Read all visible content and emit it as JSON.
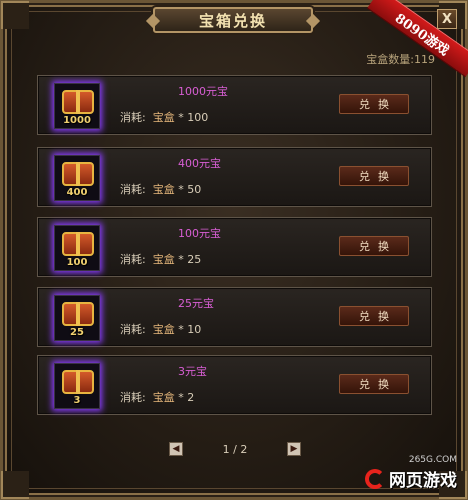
{
  "window": {
    "title": "宝箱兑换",
    "close_label": "X",
    "ribbon": "8090游戏"
  },
  "count_label": "宝盒数量:119",
  "rows": [
    {
      "name": "1000元宝",
      "cost_label": "消耗:",
      "cost_item": "宝盒",
      "cost_qty": "* 100",
      "qty": "1000",
      "exchange_label": "兑换"
    },
    {
      "name": "400元宝",
      "cost_label": "消耗:",
      "cost_item": "宝盒",
      "cost_qty": "* 50",
      "qty": "400",
      "exchange_label": "兑换"
    },
    {
      "name": "100元宝",
      "cost_label": "消耗:",
      "cost_item": "宝盒",
      "cost_qty": "* 25",
      "qty": "100",
      "exchange_label": "兑换"
    },
    {
      "name": "25元宝",
      "cost_label": "消耗:",
      "cost_item": "宝盒",
      "cost_qty": "* 10",
      "qty": "25",
      "exchange_label": "兑换"
    },
    {
      "name": "3元宝",
      "cost_label": "消耗:",
      "cost_item": "宝盒",
      "cost_qty": "* 2",
      "qty": "3",
      "exchange_label": "兑换"
    }
  ],
  "pager": {
    "prev_icon": "◀",
    "next_icon": "▶",
    "page_text": "1 / 2"
  },
  "watermark": {
    "site": "265G.COM",
    "brand": "网页游戏"
  }
}
